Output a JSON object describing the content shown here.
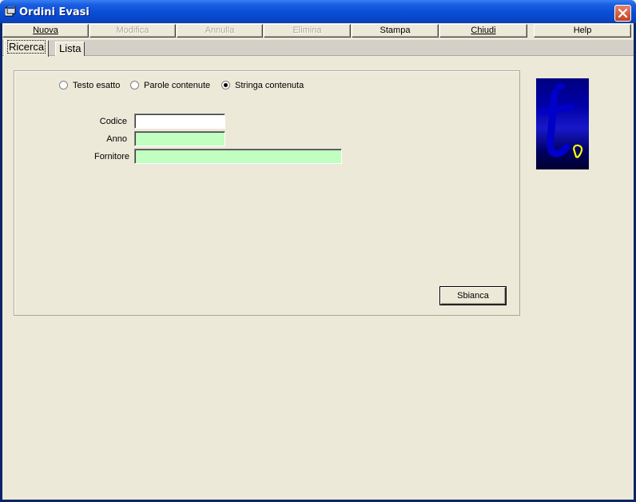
{
  "window": {
    "title": "Ordini Evasi",
    "icons": {
      "app": "app-window-icon",
      "close": "close-icon"
    },
    "colors": {
      "titlebar": "#0a4fd8",
      "close": "#d9512c"
    }
  },
  "toolbar": {
    "buttons": [
      {
        "label": "Nuova",
        "enabled": true
      },
      {
        "label": "Modifica",
        "enabled": false
      },
      {
        "label": "Annulla",
        "enabled": false
      },
      {
        "label": "Elimina",
        "enabled": false
      },
      {
        "label": "Stampa",
        "enabled": true
      },
      {
        "label": "Chiudi",
        "enabled": true
      },
      {
        "label": "Help",
        "enabled": true
      }
    ]
  },
  "tabs": [
    {
      "label": "Ricerca",
      "active": true
    },
    {
      "label": "Lista",
      "active": false
    }
  ],
  "search": {
    "modes": [
      {
        "label": "Testo esatto",
        "checked": false
      },
      {
        "label": "Parole contenute",
        "checked": false
      },
      {
        "label": "Stringa contenuta",
        "checked": true
      }
    ],
    "fields": [
      {
        "label": "Codice",
        "value": "",
        "color": "#ffffff"
      },
      {
        "label": "Anno",
        "value": "",
        "color": "#c0ffc0"
      },
      {
        "label": "Fornitore",
        "value": "",
        "color": "#c0ffc0"
      }
    ],
    "clear_label": "Sbianca"
  },
  "logo": {
    "icon": "brand-logo-icon",
    "colors": {
      "background": "#0000a8",
      "accent": "#ffff00"
    }
  }
}
